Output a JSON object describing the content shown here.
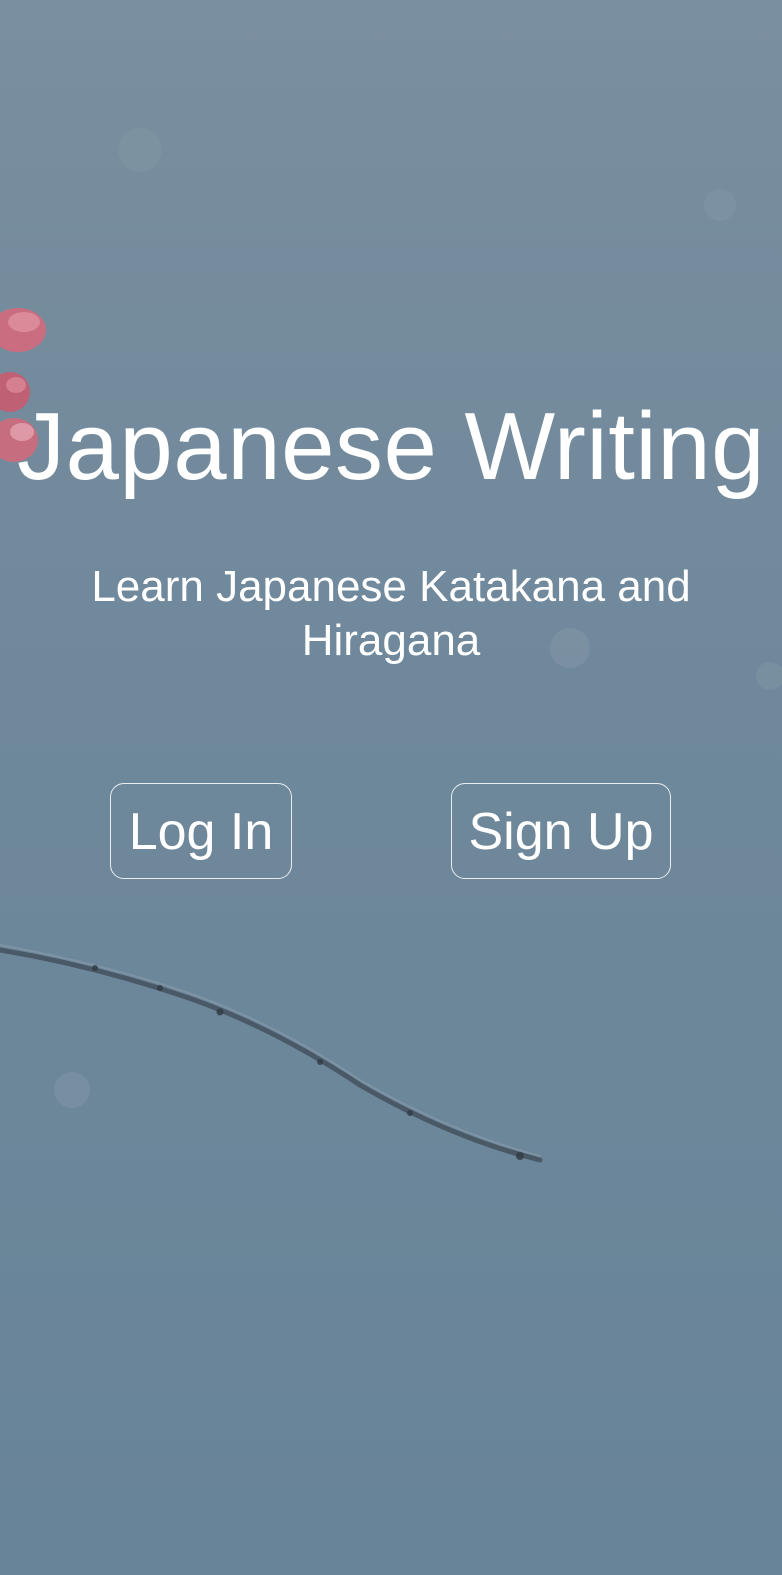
{
  "hero": {
    "title": "Japanese Writing",
    "subtitle": "Learn Japanese Katakana and Hiragana"
  },
  "actions": {
    "login_label": "Log In",
    "signup_label": "Sign Up"
  },
  "colors": {
    "background": "#6f889b",
    "text": "#ffffff",
    "blossom": "#d9697e",
    "branch": "#3f4a55"
  },
  "background_image": "cherry-blossom-branch"
}
